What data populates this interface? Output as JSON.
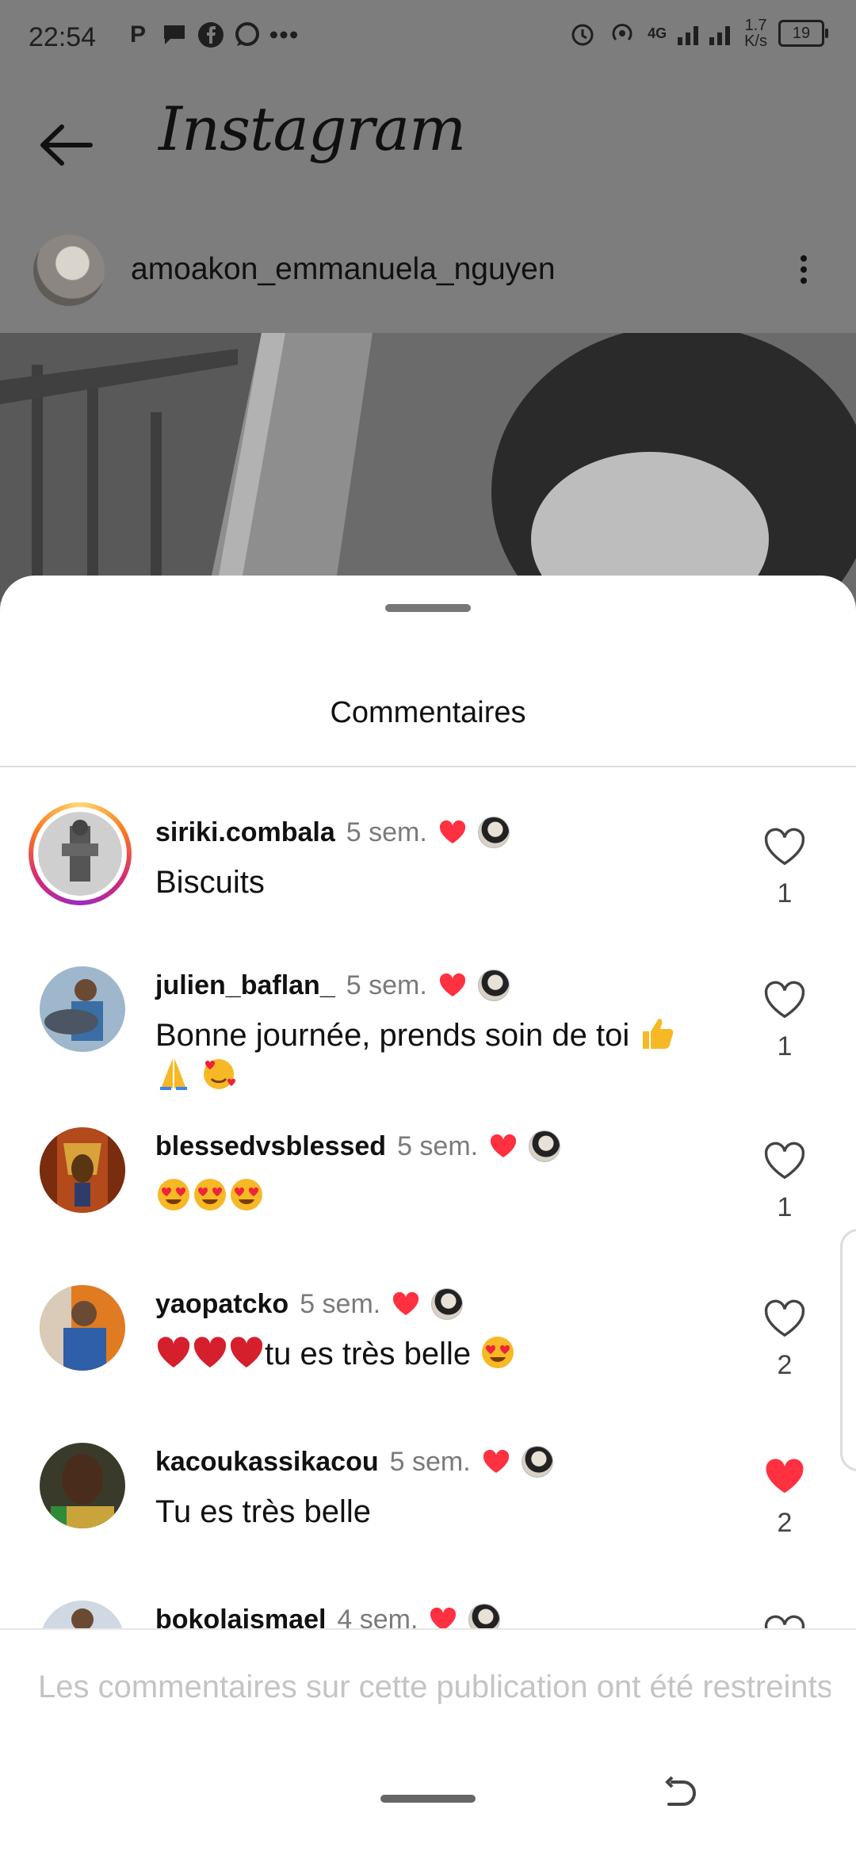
{
  "status_bar": {
    "time": "22:54",
    "left_icons": [
      "p-icon",
      "message-bubble-icon",
      "facebook-icon",
      "whatsapp-icon",
      "more-dots-icon"
    ],
    "network_label": "4G",
    "net_speed_value": "1.7",
    "net_speed_unit": "K/s",
    "battery": "19"
  },
  "header": {
    "app_title": "Instagram"
  },
  "post": {
    "username": "amoakon_emmanuela_nguyen"
  },
  "sheet": {
    "title": "Commentaires",
    "restricted_message": "Les commentaires sur cette publication ont été restreints"
  },
  "comments": [
    {
      "username": "siriki.combala",
      "time": "5 sem.",
      "text": "Biscuits",
      "emojis": [],
      "likes": "1",
      "liked": false,
      "story_ring": true
    },
    {
      "username": "julien_baflan_",
      "time": "5 sem.",
      "text": "Bonne journée, prends soin de toi",
      "emojis": [
        "thumbs-up",
        "folded-hands",
        "smiling-face-with-hearts"
      ],
      "likes": "1",
      "liked": false,
      "story_ring": false
    },
    {
      "username": "blessedvsblessed",
      "time": "5 sem.",
      "text": "",
      "emojis": [
        "heart-eyes",
        "heart-eyes",
        "heart-eyes"
      ],
      "likes": "1",
      "liked": false,
      "story_ring": false
    },
    {
      "username": "yaopatcko",
      "time": "5 sem.",
      "text": "tu es très belle",
      "emojis": [
        "red-heart",
        "red-heart",
        "red-heart",
        "heart-eyes"
      ],
      "likes": "2",
      "liked": false,
      "story_ring": false
    },
    {
      "username": "kacoukassikacou",
      "time": "5 sem.",
      "text": "Tu es très belle",
      "emojis": [],
      "likes": "2",
      "liked": true,
      "story_ring": false
    },
    {
      "username": "bokolaismael",
      "time": "4 sem.",
      "text": "",
      "emojis": [],
      "likes": "",
      "liked": false,
      "story_ring": false
    }
  ],
  "colors": {
    "like_red": "#ff3040",
    "text_primary": "#111111",
    "text_secondary": "#7a7a7a",
    "placeholder": "#c4c4c4"
  }
}
